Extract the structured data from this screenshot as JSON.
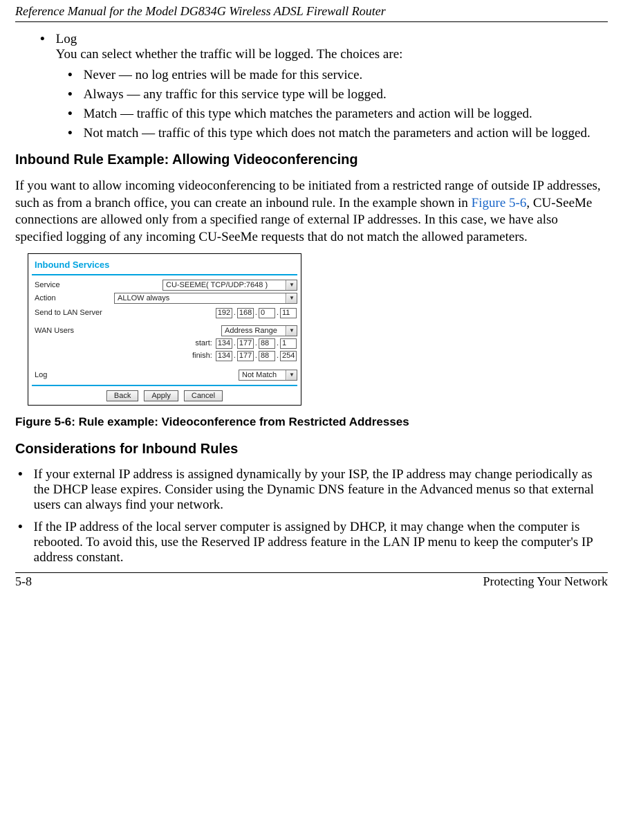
{
  "doc_header": "Reference Manual for the Model DG834G Wireless ADSL Firewall Router",
  "log_item": {
    "title": "Log",
    "desc": "You can select whether the traffic will be logged. The choices are:",
    "choices": [
      "Never — no log entries will be made for this service.",
      "Always — any traffic for this service type will be logged.",
      "Match — traffic of this type which matches the parameters and action will be logged.",
      "Not match — traffic of this type which does not match the parameters and action will be logged."
    ]
  },
  "section_inbound_title": "Inbound Rule Example: Allowing Videoconferencing",
  "inbound_para_a": "If you want to allow incoming videoconferencing to be initiated from a restricted range of outside IP addresses, such as from a branch office, you can create an inbound rule. In the example shown in ",
  "inbound_figref": "Figure 5-6",
  "inbound_para_b": ", CU-SeeMe connections are allowed only from a specified range of external IP addresses. In this case, we have also specified logging of any incoming CU-SeeMe requests that do not match the allowed parameters.",
  "panel": {
    "title": "Inbound Services",
    "labels": {
      "service": "Service",
      "action": "Action",
      "sendto": "Send to LAN Server",
      "wanusers": "WAN Users",
      "start": "start:",
      "finish": "finish:",
      "log": "Log"
    },
    "values": {
      "service": "CU-SEEME( TCP/UDP:7648 )",
      "action": "ALLOW always",
      "sendto": [
        "192",
        "168",
        "0",
        "11"
      ],
      "wanusers_mode": "Address Range",
      "start": [
        "134",
        "177",
        "88",
        "1"
      ],
      "finish": [
        "134",
        "177",
        "88",
        "254"
      ],
      "log": "Not Match"
    },
    "buttons": {
      "back": "Back",
      "apply": "Apply",
      "cancel": "Cancel"
    }
  },
  "figure_caption": "Figure 5-6:  Rule example: Videoconference from Restricted Addresses",
  "consider_title": "Considerations for Inbound Rules",
  "consider": [
    "If your external IP address is assigned dynamically by your ISP, the IP address may change periodically as the DHCP lease expires. Consider using the Dynamic DNS feature in the Advanced menus so that external users can always find your network.",
    "If the IP address of the local server computer is assigned by DHCP, it may change when the computer is rebooted. To avoid this, use the Reserved IP address feature in the LAN IP menu to keep the computer's IP address constant."
  ],
  "footer": {
    "page": "5-8",
    "section": "Protecting Your Network"
  }
}
